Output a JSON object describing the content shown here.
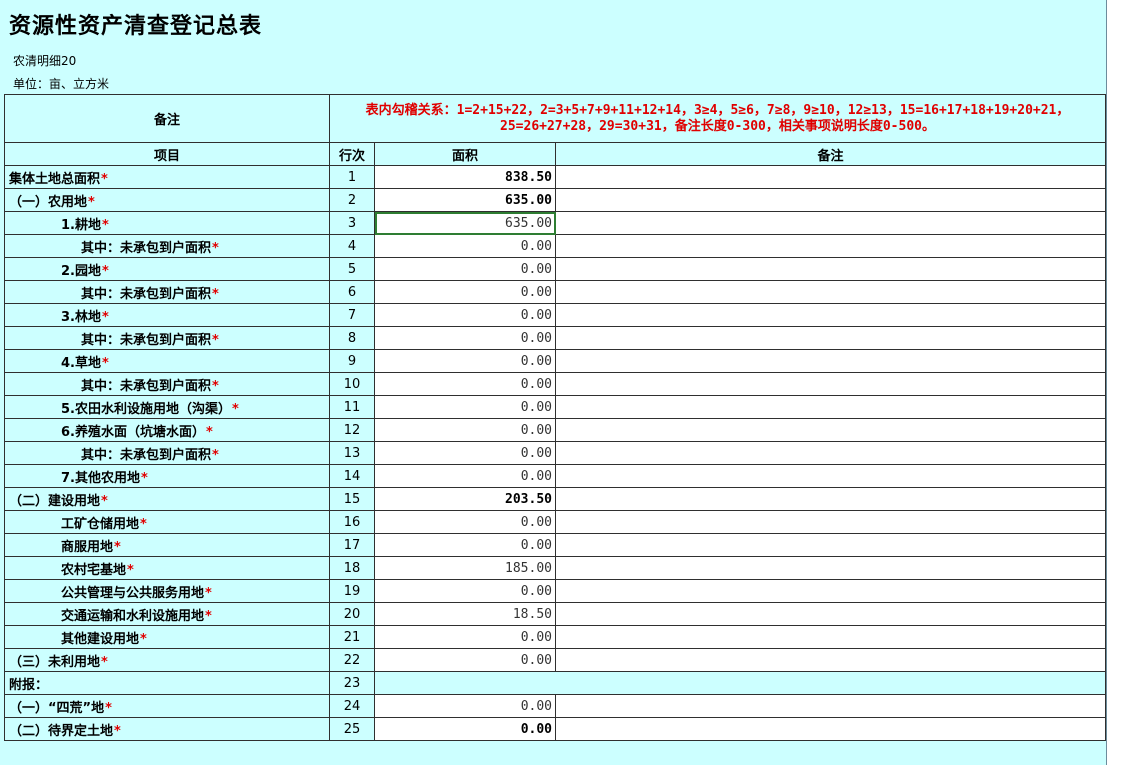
{
  "header": {
    "title": "资源性资产清查登记总表",
    "code": "农清明细20",
    "unit": "单位：亩、立方米"
  },
  "top_note": {
    "label": "备注",
    "rule_line1": "表内勾稽关系：1=2+15+22，2=3+5+7+9+11+12+14，3≥4，5≥6，7≥8，9≥10，12≥13，15=16+17+18+19+20+21，",
    "rule_line2": "25=26+27+28，29=30+31，备注长度0-300，相关事项说明长度0-500。"
  },
  "columns": {
    "item": "项目",
    "row": "行次",
    "area": "面积",
    "note": "备注"
  },
  "rows": [
    {
      "item": "集体土地总面积",
      "star": "*",
      "row": "1",
      "area": "838.50"
    },
    {
      "item": "（一）农用地",
      "star": "*",
      "row": "2",
      "area": "635.00"
    },
    {
      "item": "1.耕地",
      "star": "*",
      "row": "3",
      "area": "635.00"
    },
    {
      "item": "其中：未承包到户面积",
      "star": "*",
      "row": "4",
      "area": "0.00"
    },
    {
      "item": "2.园地",
      "star": "*",
      "row": "5",
      "area": "0.00"
    },
    {
      "item": "其中：未承包到户面积",
      "star": "*",
      "row": "6",
      "area": "0.00"
    },
    {
      "item": "3.林地",
      "star": "*",
      "row": "7",
      "area": "0.00"
    },
    {
      "item": "其中：未承包到户面积",
      "star": "*",
      "row": "8",
      "area": "0.00"
    },
    {
      "item": "4.草地",
      "star": "*",
      "row": "9",
      "area": "0.00"
    },
    {
      "item": "其中：未承包到户面积",
      "star": "*",
      "row": "10",
      "area": "0.00"
    },
    {
      "item": "5.农田水利设施用地（沟渠）",
      "star": "*",
      "row": "11",
      "area": "0.00"
    },
    {
      "item": "6.养殖水面（坑塘水面）",
      "star": "*",
      "row": "12",
      "area": "0.00"
    },
    {
      "item": "其中：未承包到户面积",
      "star": "*",
      "row": "13",
      "area": "0.00"
    },
    {
      "item": "7.其他农用地",
      "star": "*",
      "row": "14",
      "area": "0.00"
    },
    {
      "item": "（二）建设用地",
      "star": "*",
      "row": "15",
      "area": "203.50"
    },
    {
      "item": "工矿仓储用地",
      "star": "*",
      "row": "16",
      "area": "0.00"
    },
    {
      "item": "商服用地",
      "star": "*",
      "row": "17",
      "area": "0.00"
    },
    {
      "item": "农村宅基地",
      "star": "*",
      "row": "18",
      "area": "185.00"
    },
    {
      "item": "公共管理与公共服务用地",
      "star": "*",
      "row": "19",
      "area": "0.00"
    },
    {
      "item": "交通运输和水利设施用地",
      "star": "*",
      "row": "20",
      "area": "18.50"
    },
    {
      "item": "其他建设用地",
      "star": "*",
      "row": "21",
      "area": "0.00"
    },
    {
      "item": "（三）未利用地",
      "star": "*",
      "row": "22",
      "area": "0.00"
    },
    {
      "item": "附报：",
      "star": "",
      "row": "23",
      "area": ""
    },
    {
      "item": "（一）“四荒”地",
      "star": "*",
      "row": "24",
      "area": "0.00"
    },
    {
      "item": "（二）待界定土地",
      "star": "*",
      "row": "25",
      "area": "0.00"
    }
  ],
  "colors": {
    "sheet_background": "#ccffff",
    "required_star": "#e00000",
    "rule_text": "#e00000",
    "selection": "#2e7d32"
  }
}
